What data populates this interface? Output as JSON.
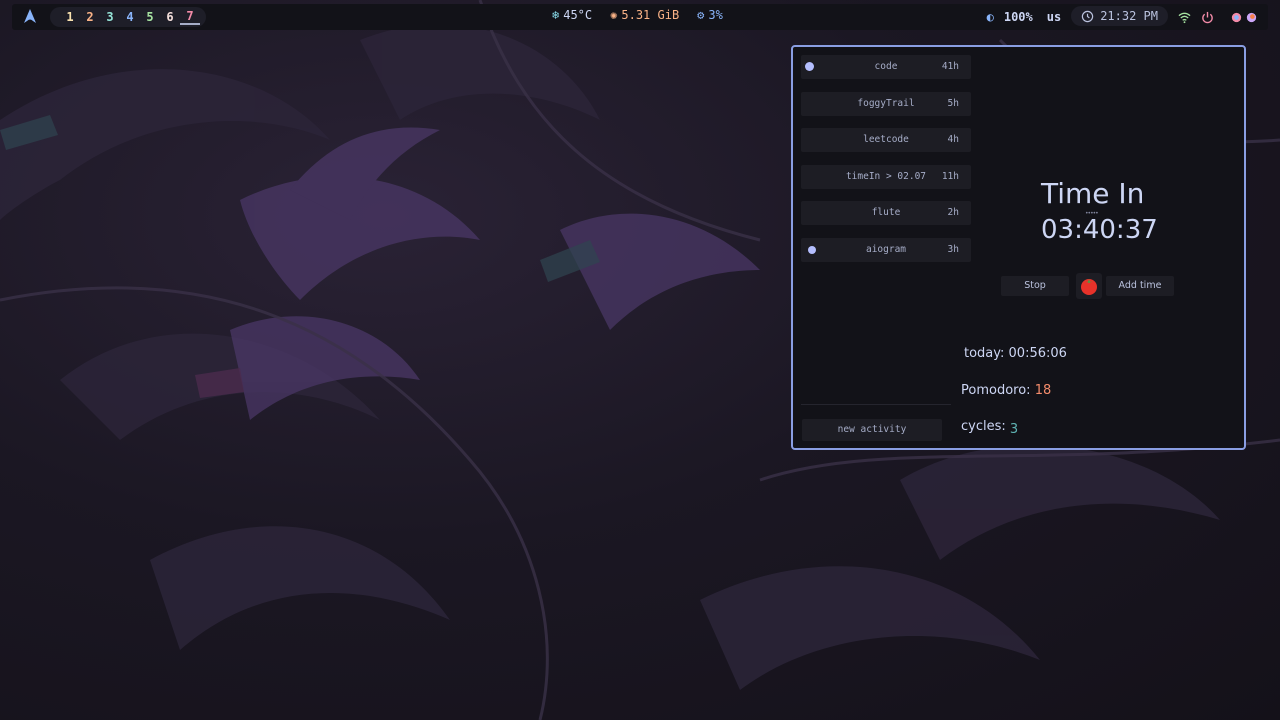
{
  "topbar": {
    "workspaces": [
      {
        "label": "1",
        "color": "#f9e2af"
      },
      {
        "label": "2",
        "color": "#fab387"
      },
      {
        "label": "3",
        "color": "#94e2d5"
      },
      {
        "label": "4",
        "color": "#89b4fa"
      },
      {
        "label": "5",
        "color": "#a6e3a1"
      },
      {
        "label": "6",
        "color": "#f5e0dc"
      },
      {
        "label": "7",
        "color": "#f38ba8"
      }
    ],
    "active_workspace": "7",
    "temperature": "45°C",
    "memory": "5.31 GiB",
    "cpu": "3%",
    "brightness": "100%",
    "keyboard_layout": "us",
    "time": "21:32 PM",
    "icons": {
      "launcher": "arch-logo-icon",
      "temp": "snowflake-icon",
      "mem": "memory-icon",
      "cpu": "cpu-icon",
      "brightness": "brightness-icon",
      "clock": "clock-icon",
      "wifi": "wifi-icon",
      "power": "power-icon"
    },
    "colors": {
      "temp": "#89dceb",
      "mem": "#fab387",
      "cpu": "#89b4fa"
    }
  },
  "timer_app": {
    "activities": [
      {
        "name": "code",
        "hours": "41h",
        "dot": true
      },
      {
        "name": "foggyTrail",
        "hours": "5h",
        "dot": false
      },
      {
        "name": "leetcode",
        "hours": "4h",
        "dot": false
      },
      {
        "name": "timeIn > 02.07",
        "hours": "11h",
        "dot": false
      },
      {
        "name": "flute",
        "hours": "2h",
        "dot": false
      },
      {
        "name": "aiogram",
        "hours": "3h",
        "dot": true
      }
    ],
    "new_activity_label": "new activity",
    "title": "Time In",
    "elapsed": "03:40:37",
    "stop_label": "Stop",
    "add_time_label": "Add time",
    "today_label": "today: 00:56:06",
    "pomodoro_label": "Pomodoro:",
    "pomodoro_value": "18",
    "cycles_label": "cycles:",
    "cycles_value": "3",
    "border_color": "#8a9ee3"
  }
}
